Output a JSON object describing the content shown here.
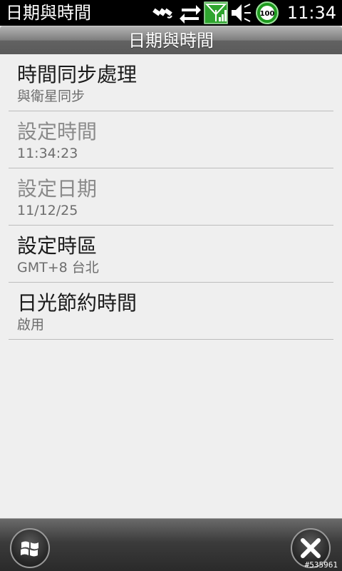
{
  "status": {
    "app_title": "日期與時間",
    "time": "11:34",
    "battery": "100"
  },
  "header": {
    "title": "日期與時間"
  },
  "items": [
    {
      "title": "時間同步處理",
      "subtitle": "與衛星同步"
    },
    {
      "title": "設定時間",
      "subtitle": "11:34:23"
    },
    {
      "title": "設定日期",
      "subtitle": "11/12/25"
    },
    {
      "title": "設定時區",
      "subtitle": "GMT+8 台北"
    },
    {
      "title": "日光節約時間",
      "subtitle": "啟用"
    }
  ],
  "watermark": "#535961",
  "colors": {
    "status_bg": "#000000",
    "list_bg": "#efefef",
    "signal_green": "#2fbf2f"
  }
}
